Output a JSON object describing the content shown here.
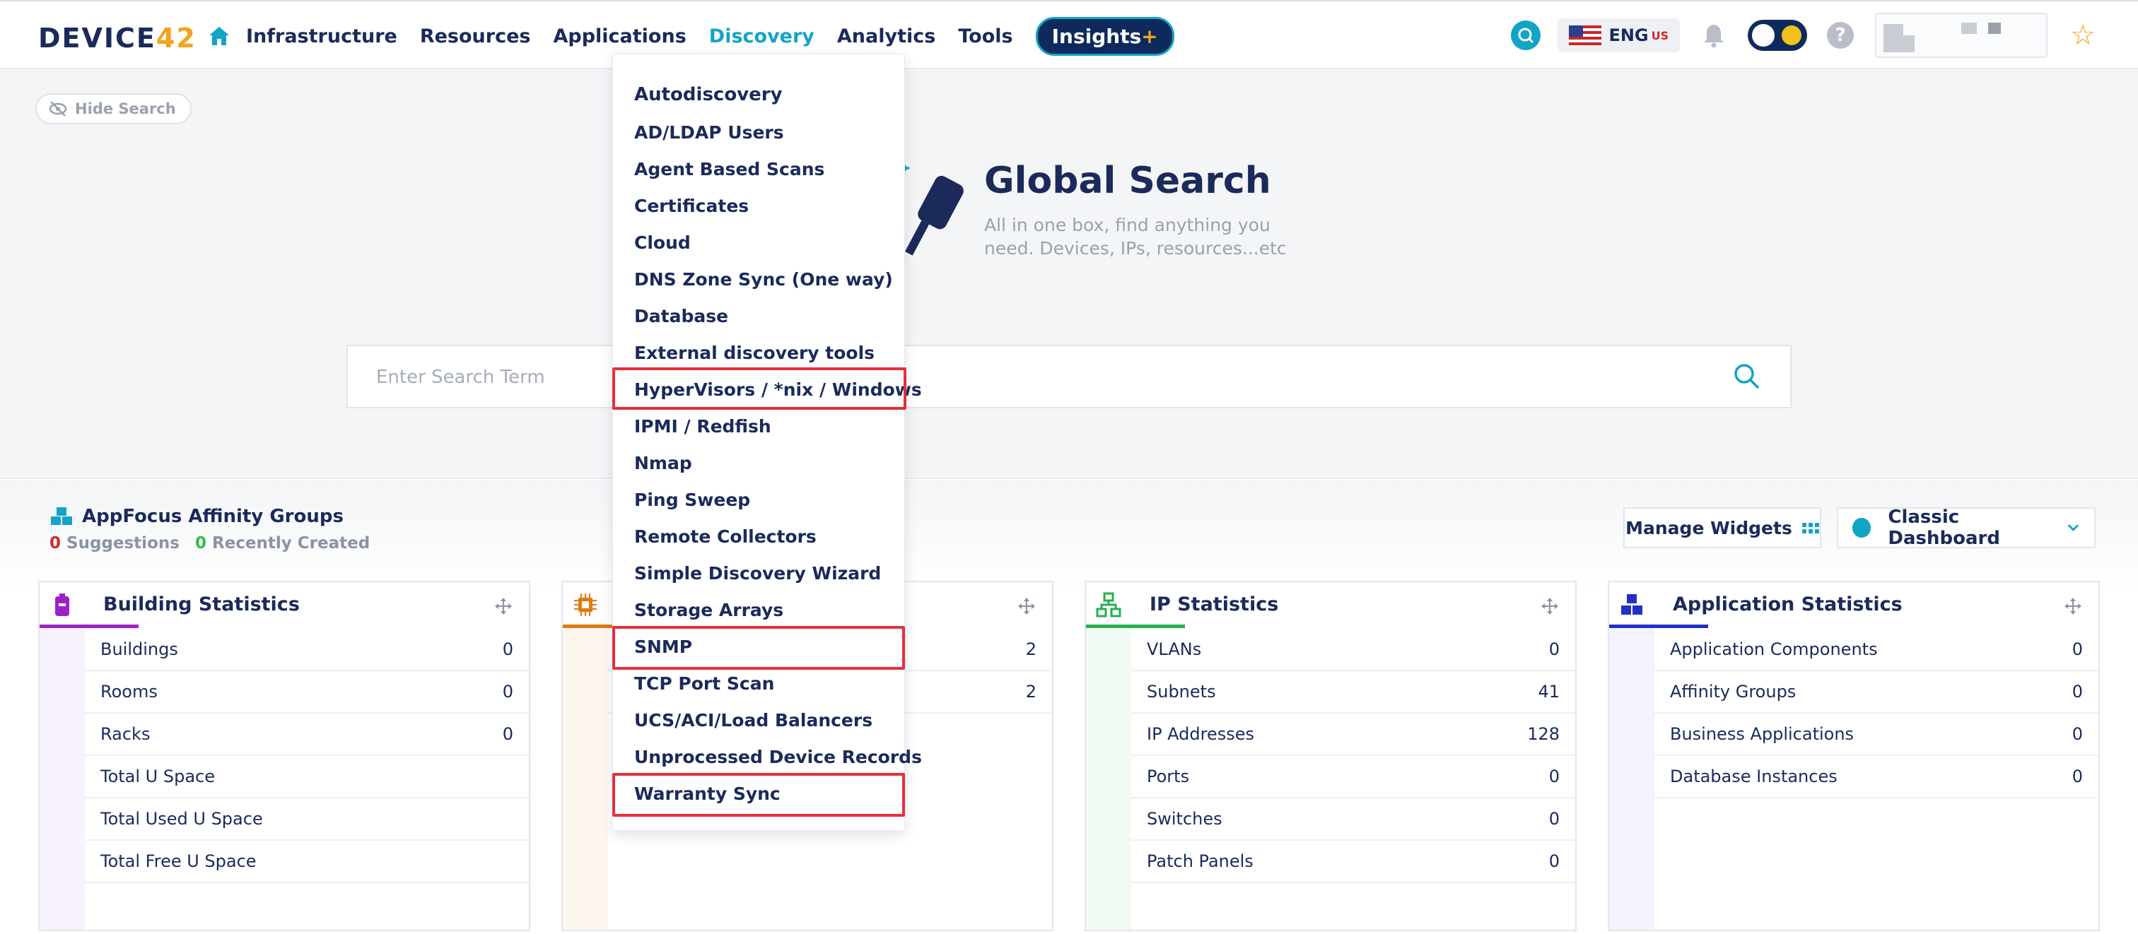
{
  "brand": {
    "logo_text": "DEVICE",
    "logo_num": "42"
  },
  "nav": {
    "items": [
      {
        "label": "Infrastructure"
      },
      {
        "label": "Resources"
      },
      {
        "label": "Applications"
      },
      {
        "label": "Discovery",
        "active": true
      },
      {
        "label": "Analytics"
      },
      {
        "label": "Tools"
      }
    ],
    "insights": {
      "label": "Insights",
      "plus": "+"
    }
  },
  "header_tools": {
    "lang": "ENG",
    "region": "US",
    "help": "?"
  },
  "hero": {
    "hide_search_label": "Hide Search",
    "title": "Global Search",
    "subtitle": "All in one box, find anything you need. Devices, IPs, resources...etc",
    "search_placeholder": "Enter Search Term"
  },
  "discovery_menu": {
    "items": [
      "Autodiscovery",
      "AD/LDAP Users",
      "Agent Based Scans",
      "Certificates",
      "Cloud",
      "DNS Zone Sync (One way)",
      "Database",
      "External discovery tools",
      "HyperVisors / *nix / Windows",
      "IPMI / Redfish",
      "Nmap",
      "Ping Sweep",
      "Remote Collectors",
      "Simple Discovery Wizard",
      "Storage Arrays",
      "SNMP",
      "TCP Port Scan",
      "UCS/ACI/Load Balancers",
      "Unprocessed Device Records",
      "Warranty Sync"
    ],
    "highlighted": [
      "HyperVisors / *nix / Windows",
      "SNMP",
      "Warranty Sync"
    ]
  },
  "affinity": {
    "title": "AppFocus Affinity Groups",
    "suggestions_count": "0",
    "suggestions_label": "Suggestions",
    "recent_count": "0",
    "recent_label": "Recently Created"
  },
  "dashboard": {
    "manage_widgets_label": "Manage Widgets",
    "selected_dashboard": "Classic Dashboard"
  },
  "colors": {
    "brand_navy": "#1b2a5a",
    "accent_teal": "#12a4c6",
    "highlight_red": "#e5303b",
    "building_accent": "#9b22c7",
    "device_accent": "#e07a12",
    "ip_accent": "#22b14c",
    "app_accent": "#2230c7"
  },
  "cards": {
    "building": {
      "title": "Building Statistics",
      "rows": [
        {
          "label": "Buildings",
          "value": "0"
        },
        {
          "label": "Rooms",
          "value": "0"
        },
        {
          "label": "Racks",
          "value": "0"
        },
        {
          "label": "Total U Space",
          "value": ""
        },
        {
          "label": "Total Used U Space",
          "value": ""
        },
        {
          "label": "Total Free U Space",
          "value": ""
        }
      ]
    },
    "devices": {
      "title": "",
      "rows": [
        {
          "label": "",
          "value": "2"
        },
        {
          "label": "",
          "value": "2"
        }
      ]
    },
    "ip": {
      "title": "IP Statistics",
      "rows": [
        {
          "label": "VLANs",
          "value": "0"
        },
        {
          "label": "Subnets",
          "value": "41"
        },
        {
          "label": "IP Addresses",
          "value": "128"
        },
        {
          "label": "Ports",
          "value": "0"
        },
        {
          "label": "Switches",
          "value": "0"
        },
        {
          "label": "Patch Panels",
          "value": "0"
        }
      ]
    },
    "application": {
      "title": "Application Statistics",
      "rows": [
        {
          "label": "Application Components",
          "value": "0"
        },
        {
          "label": "Affinity Groups",
          "value": "0"
        },
        {
          "label": "Business Applications",
          "value": "0"
        },
        {
          "label": "Database Instances",
          "value": "0"
        }
      ]
    }
  }
}
